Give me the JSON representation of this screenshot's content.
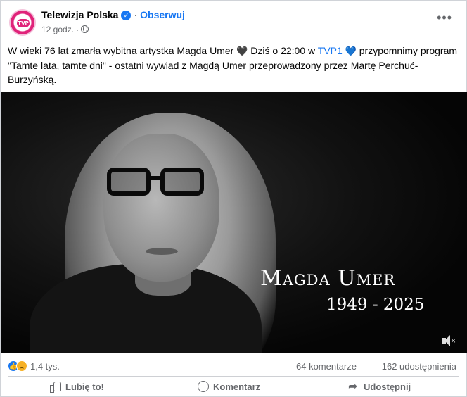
{
  "post": {
    "page_name": "Telewizja Polska",
    "verified_icon": "verified-badge-icon",
    "separator": "·",
    "follow_label": "Obserwuj",
    "time": "12 godz.",
    "audience_icon": "globe-icon",
    "more_label": "•••",
    "avatar_logo": "TVP",
    "text_part1": "W wieki 76 lat zmarła wybitna artystka Magda Umer",
    "text_part2": "Dziś o 22:00 w",
    "tag": "TVP1",
    "text_part3": "przypomnimy program \"Tamte lata, tamte dni\" - ostatni wywiad z Magdą Umer przeprowadzony przez Martę Perchuć- Burzyńską.",
    "emoji_dark_heart": "🖤",
    "emoji_blue_heart": "💙"
  },
  "media": {
    "caption_name": "Magda Umer",
    "caption_years": "1949 - 2025",
    "mute_icon": "speaker-muted-icon",
    "mute_x": "×"
  },
  "stats": {
    "reactions_count": "1,4 tys.",
    "comments": "64 komentarze",
    "shares": "162 udostępnienia",
    "like_reaction_icon": "👍"
  },
  "actions": {
    "like": "Lubię to!",
    "comment": "Komentarz",
    "share": "Udostępnij"
  },
  "colors": {
    "accent": "#1877f2",
    "brand": "#e0237a",
    "muted_text": "#65676b"
  }
}
